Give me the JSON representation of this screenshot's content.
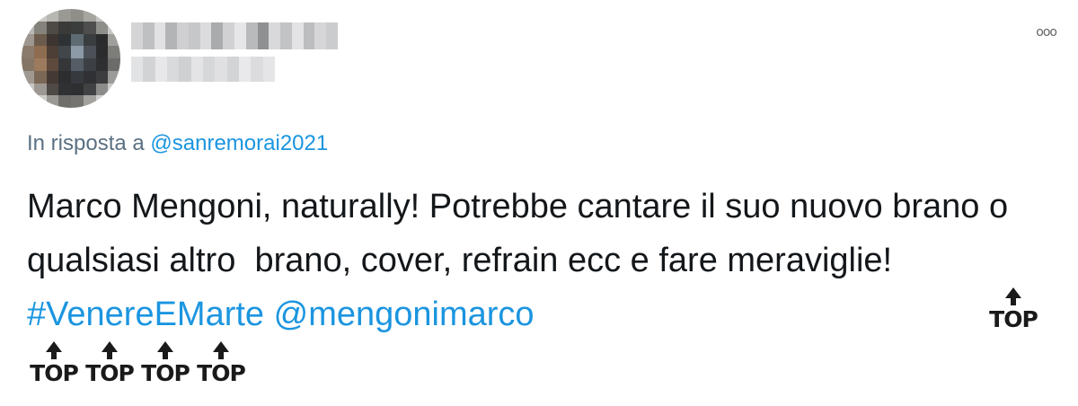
{
  "header": {
    "more_icon": "more-options-icon",
    "more_glyph": "ooo"
  },
  "reply": {
    "prefix": "In risposta a ",
    "mention": "@sanremorai2021"
  },
  "tweet": {
    "text": "Marco Mengoni, naturally! Potrebbe cantare il suo nuovo brano o qualsiasi altro  brano, cover, refrain ecc e fare meraviglie! ",
    "hashtag": "#VenereEMarte",
    "mention": "@mengonimarco",
    "emoji_label": "TOP"
  },
  "colors": {
    "link": "#1b95e0",
    "muted": "#5b7083",
    "text": "#14171a"
  }
}
